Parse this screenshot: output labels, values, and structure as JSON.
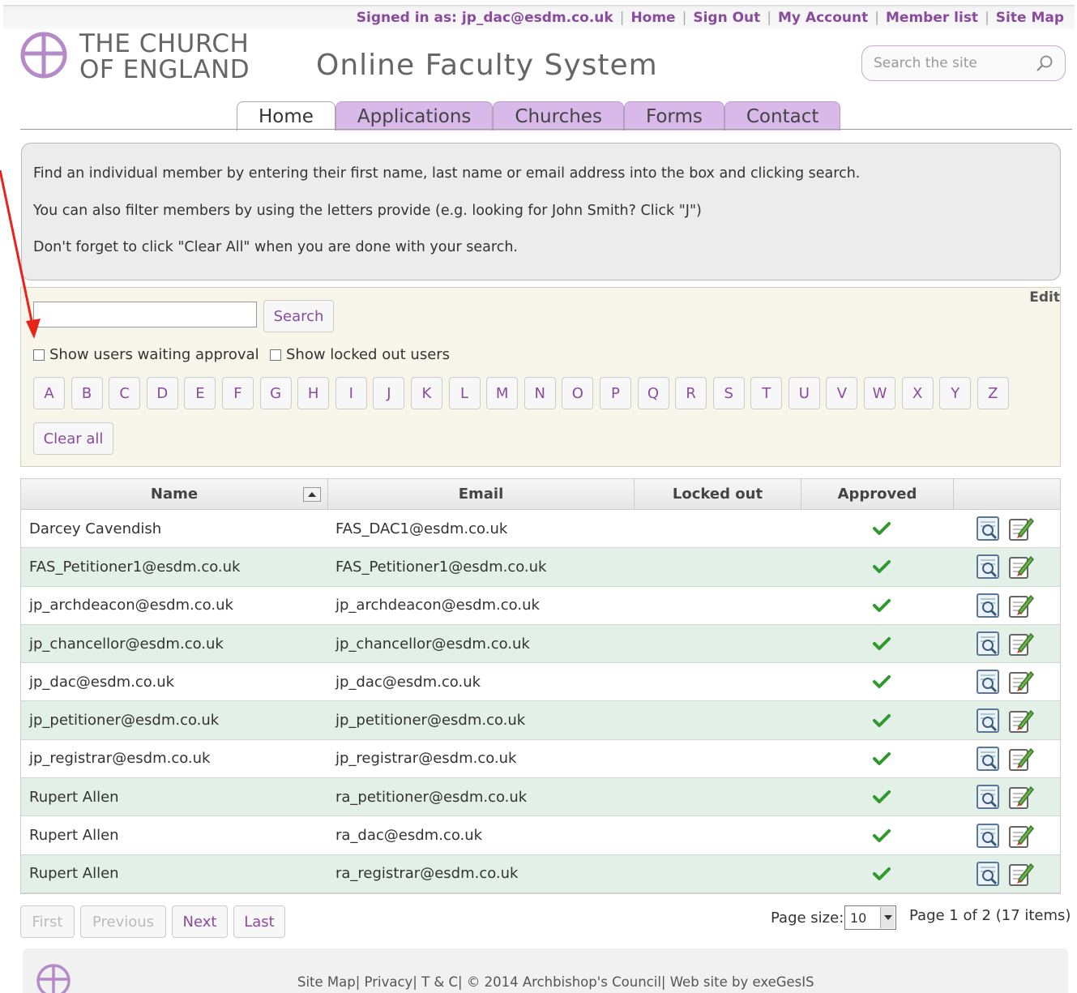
{
  "topnav": {
    "signed_in": "Signed in as: jp_dac@esdm.co.uk",
    "home": "Home",
    "sign_out": "Sign Out",
    "my_account": "My Account",
    "member_list": "Member list",
    "site_map": "Site Map"
  },
  "brand": {
    "line1": "THE CHURCH",
    "line2": "OF ENGLAND",
    "site_title": "Online Faculty System",
    "accent": "#8a4a9e"
  },
  "site_search": {
    "placeholder": "Search the site"
  },
  "tabs": [
    {
      "label": "Home",
      "active": true
    },
    {
      "label": "Applications",
      "active": false
    },
    {
      "label": "Churches",
      "active": false
    },
    {
      "label": "Forms",
      "active": false
    },
    {
      "label": "Contact",
      "active": false
    }
  ],
  "info": {
    "line1": "Find an individual member by entering their first name, last name or email address into the box and clicking search.",
    "line2": "You can also filter members by using the letters provide (e.g. looking for John Smith? Click \"J\")",
    "line3": "Don't forget to click \"Clear All\" when you are done with your search."
  },
  "filter": {
    "edit": "Edit",
    "search_value": "",
    "search_button": "Search",
    "waiting_approval": "Show users waiting approval",
    "locked_out": "Show locked out users",
    "letters": [
      "A",
      "B",
      "C",
      "D",
      "E",
      "F",
      "G",
      "H",
      "I",
      "J",
      "K",
      "L",
      "M",
      "N",
      "O",
      "P",
      "Q",
      "R",
      "S",
      "T",
      "U",
      "V",
      "W",
      "X",
      "Y",
      "Z"
    ],
    "clear_all": "Clear all"
  },
  "table": {
    "headers": {
      "name": "Name",
      "email": "Email",
      "locked": "Locked out",
      "approved": "Approved"
    },
    "rows": [
      {
        "name": "Darcey Cavendish",
        "email": "FAS_DAC1@esdm.co.uk",
        "locked": "",
        "approved": true
      },
      {
        "name": "FAS_Petitioner1@esdm.co.uk",
        "email": "FAS_Petitioner1@esdm.co.uk",
        "locked": "",
        "approved": true
      },
      {
        "name": "jp_archdeacon@esdm.co.uk",
        "email": "jp_archdeacon@esdm.co.uk",
        "locked": "",
        "approved": true
      },
      {
        "name": "jp_chancellor@esdm.co.uk",
        "email": "jp_chancellor@esdm.co.uk",
        "locked": "",
        "approved": true
      },
      {
        "name": "jp_dac@esdm.co.uk",
        "email": "jp_dac@esdm.co.uk",
        "locked": "",
        "approved": true
      },
      {
        "name": "jp_petitioner@esdm.co.uk",
        "email": "jp_petitioner@esdm.co.uk",
        "locked": "",
        "approved": true
      },
      {
        "name": "jp_registrar@esdm.co.uk",
        "email": "jp_registrar@esdm.co.uk",
        "locked": "",
        "approved": true
      },
      {
        "name": "Rupert Allen",
        "email": "ra_petitioner@esdm.co.uk",
        "locked": "",
        "approved": true
      },
      {
        "name": "Rupert Allen",
        "email": "ra_dac@esdm.co.uk",
        "locked": "",
        "approved": true
      },
      {
        "name": "Rupert Allen",
        "email": "ra_registrar@esdm.co.uk",
        "locked": "",
        "approved": true
      }
    ],
    "approved_color": "#2e9a2e"
  },
  "pager": {
    "first": "First",
    "previous": "Previous",
    "next": "Next",
    "last": "Last",
    "page_size_label": "Page size:",
    "page_size": "10",
    "page_info": "Page 1 of 2 (17 items)"
  },
  "footer": {
    "text": "Site Map| Privacy| T & C| © 2014 Archbishop's Council| Web site by exeGesIS"
  },
  "annotation": {
    "arrow_color": "#e8241a"
  }
}
